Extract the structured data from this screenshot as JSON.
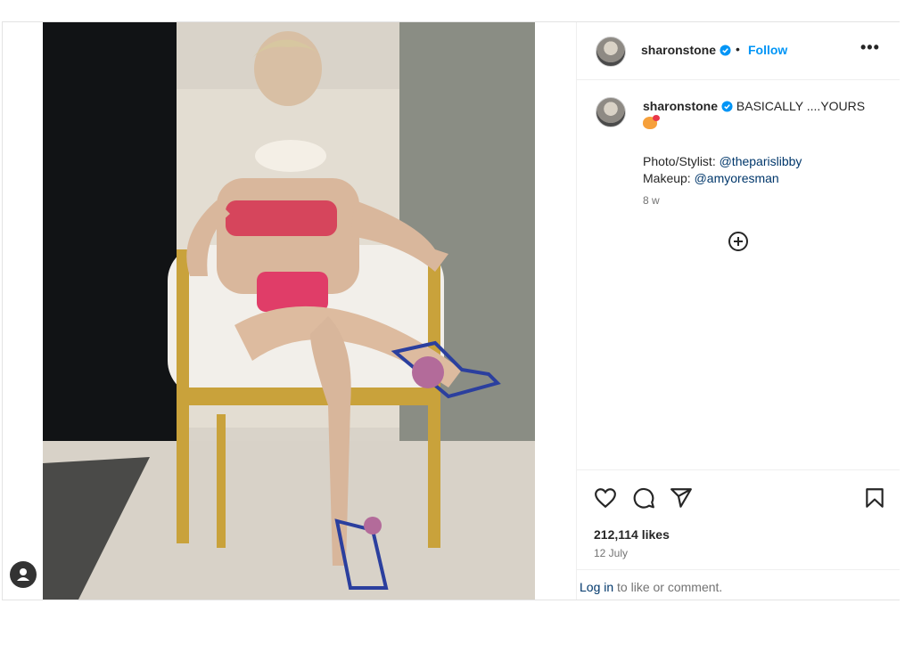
{
  "post": {
    "username": "sharonstone",
    "follow_label": "Follow",
    "separator": "•",
    "more_label": "•••",
    "caption": {
      "username": "sharonstone",
      "text": "BASICALLY ....YOURS",
      "credit_photo_prefix": "Photo/Stylist: ",
      "credit_photo_handle": "@theparislibby",
      "credit_makeup_prefix": "Makeup: ",
      "credit_makeup_handle": "@amyoresman",
      "time_ago": "8 w"
    },
    "likes": "212,114 likes",
    "date": "12 July",
    "login_link": "Log in",
    "login_suffix": " to like or comment."
  },
  "colors": {
    "accent": "#0095f6",
    "mention": "#00376b",
    "muted": "#737373",
    "verified": "#0095f6"
  },
  "icons": [
    "verified-badge-icon",
    "more-options-icon",
    "add-comment-icon",
    "heart-icon",
    "comment-icon",
    "share-icon",
    "bookmark-icon",
    "user-icon"
  ]
}
